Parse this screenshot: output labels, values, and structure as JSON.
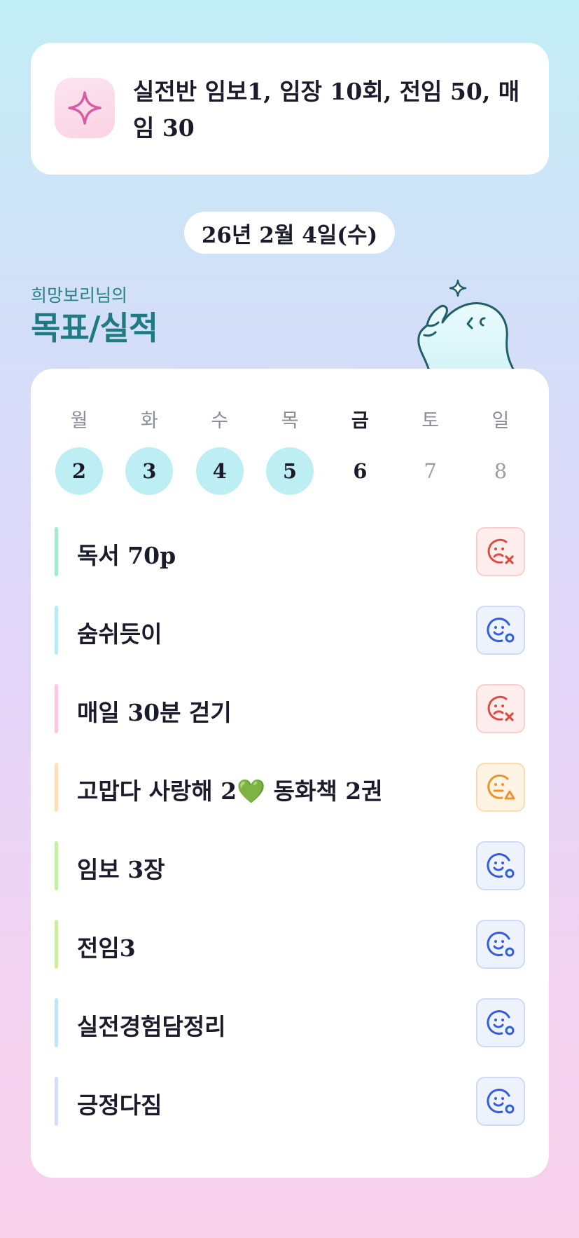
{
  "goal_card": {
    "icon": "sparkle-icon",
    "text": "실전반 임보1, 임장 10회, 전임 50, 매임 30"
  },
  "date": "26년 2월 4일(수)",
  "owner": {
    "subtitle": "희망보리님의",
    "title": "목표/실적"
  },
  "week": {
    "days": [
      {
        "label": "월",
        "num": "2",
        "state": "done"
      },
      {
        "label": "화",
        "num": "3",
        "state": "done"
      },
      {
        "label": "수",
        "num": "4",
        "state": "done"
      },
      {
        "label": "목",
        "num": "5",
        "state": "done"
      },
      {
        "label": "금",
        "num": "6",
        "state": "today"
      },
      {
        "label": "토",
        "num": "7",
        "state": "future"
      },
      {
        "label": "일",
        "num": "8",
        "state": "future"
      }
    ]
  },
  "tasks": [
    {
      "label": "독서 70p",
      "bar_color": "#a7e9cf",
      "status": "fail",
      "icon": "sad-face-x-icon"
    },
    {
      "label": "숨쉬듯이",
      "bar_color": "#b9ecf2",
      "status": "ok",
      "icon": "smile-face-o-icon"
    },
    {
      "label": "매일 30분 걷기",
      "bar_color": "#fbc7e2",
      "status": "fail",
      "icon": "sad-face-x-icon"
    },
    {
      "label": "고맙다 사랑해 2💚 동화책 2권",
      "bar_color": "#fde0b8",
      "status": "partial",
      "icon": "neutral-face-triangle-icon"
    },
    {
      "label": "임보 3장",
      "bar_color": "#c8eda5",
      "status": "ok",
      "icon": "smile-face-o-icon"
    },
    {
      "label": "전임3",
      "bar_color": "#cdeea2",
      "status": "ok",
      "icon": "smile-face-o-icon"
    },
    {
      "label": "실전경험담정리",
      "bar_color": "#bfe6f5",
      "status": "ok",
      "icon": "smile-face-o-icon"
    },
    {
      "label": "긍정다짐",
      "bar_color": "#d5ddf7",
      "status": "ok",
      "icon": "smile-face-o-icon"
    }
  ],
  "colors": {
    "fail": "#e5483d",
    "ok": "#2f5fe0",
    "partial": "#f0922a",
    "accent": "#1f7a82"
  }
}
